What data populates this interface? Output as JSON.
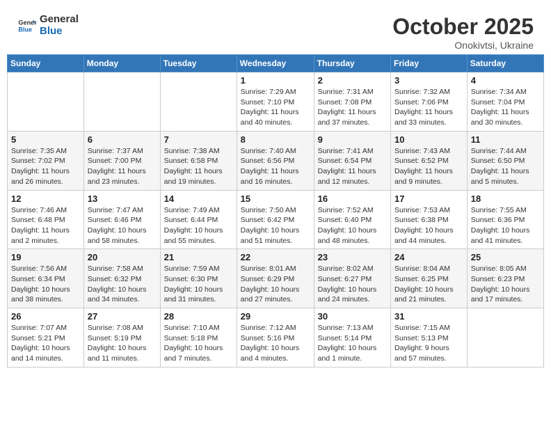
{
  "header": {
    "logo_line1": "General",
    "logo_line2": "Blue",
    "month": "October 2025",
    "location": "Onokivtsi, Ukraine"
  },
  "weekdays": [
    "Sunday",
    "Monday",
    "Tuesday",
    "Wednesday",
    "Thursday",
    "Friday",
    "Saturday"
  ],
  "weeks": [
    [
      {
        "day": "",
        "info": ""
      },
      {
        "day": "",
        "info": ""
      },
      {
        "day": "",
        "info": ""
      },
      {
        "day": "1",
        "info": "Sunrise: 7:29 AM\nSunset: 7:10 PM\nDaylight: 11 hours\nand 40 minutes."
      },
      {
        "day": "2",
        "info": "Sunrise: 7:31 AM\nSunset: 7:08 PM\nDaylight: 11 hours\nand 37 minutes."
      },
      {
        "day": "3",
        "info": "Sunrise: 7:32 AM\nSunset: 7:06 PM\nDaylight: 11 hours\nand 33 minutes."
      },
      {
        "day": "4",
        "info": "Sunrise: 7:34 AM\nSunset: 7:04 PM\nDaylight: 11 hours\nand 30 minutes."
      }
    ],
    [
      {
        "day": "5",
        "info": "Sunrise: 7:35 AM\nSunset: 7:02 PM\nDaylight: 11 hours\nand 26 minutes."
      },
      {
        "day": "6",
        "info": "Sunrise: 7:37 AM\nSunset: 7:00 PM\nDaylight: 11 hours\nand 23 minutes."
      },
      {
        "day": "7",
        "info": "Sunrise: 7:38 AM\nSunset: 6:58 PM\nDaylight: 11 hours\nand 19 minutes."
      },
      {
        "day": "8",
        "info": "Sunrise: 7:40 AM\nSunset: 6:56 PM\nDaylight: 11 hours\nand 16 minutes."
      },
      {
        "day": "9",
        "info": "Sunrise: 7:41 AM\nSunset: 6:54 PM\nDaylight: 11 hours\nand 12 minutes."
      },
      {
        "day": "10",
        "info": "Sunrise: 7:43 AM\nSunset: 6:52 PM\nDaylight: 11 hours\nand 9 minutes."
      },
      {
        "day": "11",
        "info": "Sunrise: 7:44 AM\nSunset: 6:50 PM\nDaylight: 11 hours\nand 5 minutes."
      }
    ],
    [
      {
        "day": "12",
        "info": "Sunrise: 7:46 AM\nSunset: 6:48 PM\nDaylight: 11 hours\nand 2 minutes."
      },
      {
        "day": "13",
        "info": "Sunrise: 7:47 AM\nSunset: 6:46 PM\nDaylight: 10 hours\nand 58 minutes."
      },
      {
        "day": "14",
        "info": "Sunrise: 7:49 AM\nSunset: 6:44 PM\nDaylight: 10 hours\nand 55 minutes."
      },
      {
        "day": "15",
        "info": "Sunrise: 7:50 AM\nSunset: 6:42 PM\nDaylight: 10 hours\nand 51 minutes."
      },
      {
        "day": "16",
        "info": "Sunrise: 7:52 AM\nSunset: 6:40 PM\nDaylight: 10 hours\nand 48 minutes."
      },
      {
        "day": "17",
        "info": "Sunrise: 7:53 AM\nSunset: 6:38 PM\nDaylight: 10 hours\nand 44 minutes."
      },
      {
        "day": "18",
        "info": "Sunrise: 7:55 AM\nSunset: 6:36 PM\nDaylight: 10 hours\nand 41 minutes."
      }
    ],
    [
      {
        "day": "19",
        "info": "Sunrise: 7:56 AM\nSunset: 6:34 PM\nDaylight: 10 hours\nand 38 minutes."
      },
      {
        "day": "20",
        "info": "Sunrise: 7:58 AM\nSunset: 6:32 PM\nDaylight: 10 hours\nand 34 minutes."
      },
      {
        "day": "21",
        "info": "Sunrise: 7:59 AM\nSunset: 6:30 PM\nDaylight: 10 hours\nand 31 minutes."
      },
      {
        "day": "22",
        "info": "Sunrise: 8:01 AM\nSunset: 6:29 PM\nDaylight: 10 hours\nand 27 minutes."
      },
      {
        "day": "23",
        "info": "Sunrise: 8:02 AM\nSunset: 6:27 PM\nDaylight: 10 hours\nand 24 minutes."
      },
      {
        "day": "24",
        "info": "Sunrise: 8:04 AM\nSunset: 6:25 PM\nDaylight: 10 hours\nand 21 minutes."
      },
      {
        "day": "25",
        "info": "Sunrise: 8:05 AM\nSunset: 6:23 PM\nDaylight: 10 hours\nand 17 minutes."
      }
    ],
    [
      {
        "day": "26",
        "info": "Sunrise: 7:07 AM\nSunset: 5:21 PM\nDaylight: 10 hours\nand 14 minutes."
      },
      {
        "day": "27",
        "info": "Sunrise: 7:08 AM\nSunset: 5:19 PM\nDaylight: 10 hours\nand 11 minutes."
      },
      {
        "day": "28",
        "info": "Sunrise: 7:10 AM\nSunset: 5:18 PM\nDaylight: 10 hours\nand 7 minutes."
      },
      {
        "day": "29",
        "info": "Sunrise: 7:12 AM\nSunset: 5:16 PM\nDaylight: 10 hours\nand 4 minutes."
      },
      {
        "day": "30",
        "info": "Sunrise: 7:13 AM\nSunset: 5:14 PM\nDaylight: 10 hours\nand 1 minute."
      },
      {
        "day": "31",
        "info": "Sunrise: 7:15 AM\nSunset: 5:13 PM\nDaylight: 9 hours\nand 57 minutes."
      },
      {
        "day": "",
        "info": ""
      }
    ]
  ]
}
